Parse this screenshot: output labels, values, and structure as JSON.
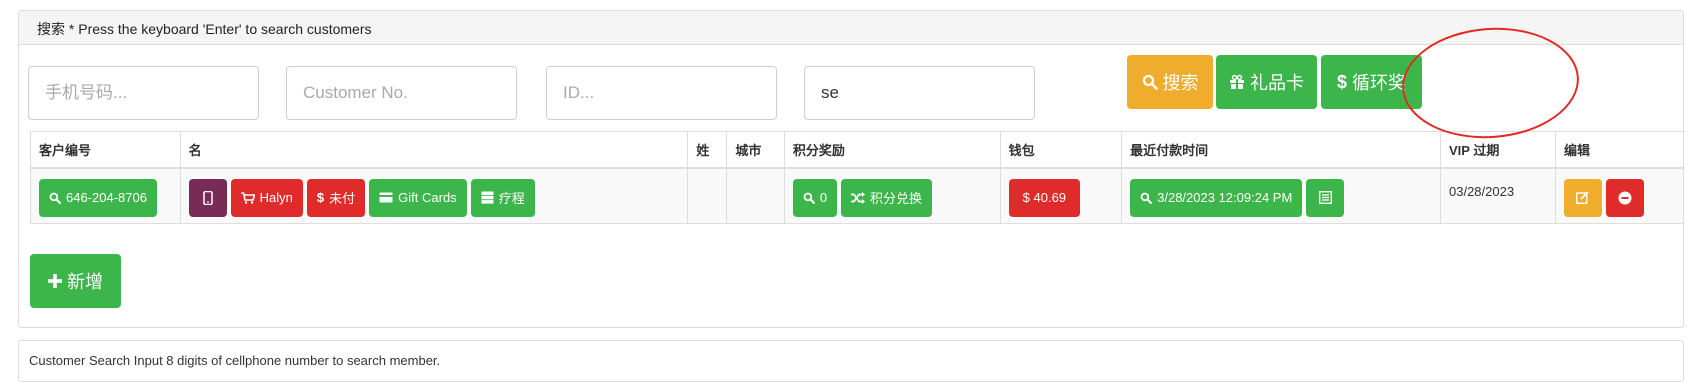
{
  "search_panel": {
    "heading": "搜索 * Press the keyboard 'Enter' to search customers",
    "inputs": {
      "phone_placeholder": "手机号码...",
      "customer_no_placeholder": "Customer No.",
      "id_placeholder": "ID...",
      "name_value": "se"
    },
    "buttons": {
      "search": "搜索",
      "gift_card": "礼品卡",
      "cycle_reward": "循环奖"
    }
  },
  "table": {
    "headers": [
      "客户编号",
      "名",
      "姓",
      "城市",
      "积分奖励",
      "钱包",
      "最近付款时间",
      "VIP 过期",
      "编辑"
    ],
    "rows": [
      {
        "customer_no": "646-204-8706",
        "name_buttons": {
          "name": "Halyn",
          "unpaid": "未付",
          "gift_cards": "Gift Cards",
          "treatment": "疗程"
        },
        "last_name": "",
        "city": "",
        "points": "0",
        "points_redeem": "积分兑换",
        "wallet": "$ 40.69",
        "last_payment": "3/28/2023 12:09:24 PM",
        "vip_expiry": "03/28/2023"
      }
    ]
  },
  "add_button": "新增",
  "footer_text": "Customer Search Input 8 digits of cellphone number to search member.",
  "colors": {
    "success": "#3cb54a",
    "warning": "#f0ad2d",
    "danger": "#e02b2b",
    "purple": "#7a2a56",
    "annotation_circle": "#e22b20"
  }
}
